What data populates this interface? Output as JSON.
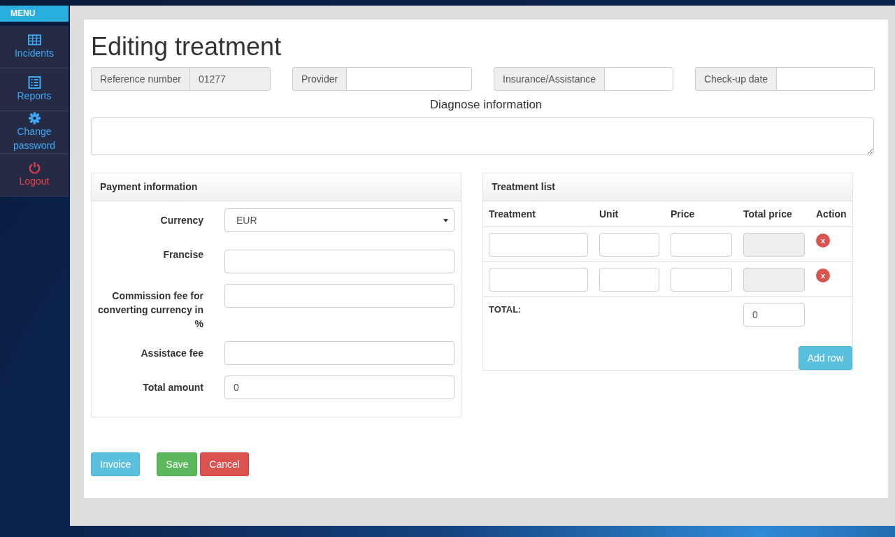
{
  "sidebar": {
    "header": "MENU",
    "items": [
      {
        "label": "Incidents",
        "kind": "grid"
      },
      {
        "label": "Reports",
        "kind": "list"
      },
      {
        "label": "Change password",
        "kind": "gear"
      },
      {
        "label": "Logout",
        "kind": "power"
      }
    ]
  },
  "title": "Editing treatment",
  "top_fields": [
    {
      "label": "Reference number",
      "value": "01277",
      "readonly": true
    },
    {
      "label": "Provider",
      "readonly": false
    },
    {
      "label": "Insurance/Assistance",
      "readonly": false
    },
    {
      "label": "Check-up date",
      "readonly": false
    }
  ],
  "diagnose": {
    "label": "Diagnose information"
  },
  "payment": {
    "title": "Payment information",
    "fields": [
      {
        "label": "Currency",
        "kind": "select",
        "value": "EUR"
      },
      {
        "label": "Francise",
        "kind": "input"
      },
      {
        "label": "Commission fee for converting currency in %",
        "kind": "input"
      },
      {
        "label": "Assistace fee",
        "kind": "input"
      },
      {
        "label": "Total amount",
        "kind": "input",
        "value": "0"
      }
    ]
  },
  "treatments": {
    "title": "Treatment list",
    "columns": [
      "Treatment",
      "Unit",
      "Price",
      "Total price",
      "Action"
    ],
    "rows": [
      {
        "delete": "x"
      },
      {
        "delete": "x"
      }
    ],
    "total_label": "TOTAL:",
    "total_value": "0",
    "add_button": "Add row"
  },
  "buttons": [
    {
      "label": "Invoice",
      "kind": "info"
    },
    {
      "label": "Save",
      "kind": "success"
    },
    {
      "label": "Cancel",
      "kind": "danger"
    }
  ]
}
